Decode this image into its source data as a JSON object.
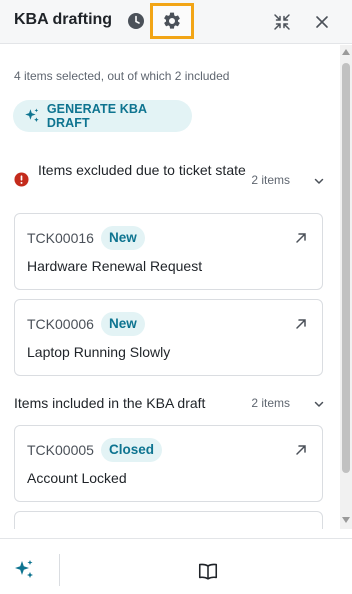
{
  "header": {
    "title": "KBA drafting",
    "icons": {
      "history": "clock-history-icon",
      "settings": "gear-icon",
      "collapse": "collapse-arrows-icon",
      "close": "close-icon"
    },
    "highlight_color": "#f2a516"
  },
  "summary": "4 items selected, out of which 2 included",
  "generate_button": {
    "label": "GENERATE KBA DRAFT",
    "icon": "sparkles-icon"
  },
  "excluded_section": {
    "title": "Items excluded due to ticket state",
    "count": "2 items",
    "icon": "error-circle-icon",
    "status_color": "#c42b1c",
    "items": [
      {
        "id": "TCK00016",
        "status": "New",
        "title": "Hardware Renewal Request"
      },
      {
        "id": "TCK00006",
        "status": "New",
        "title": "Laptop Running Slowly"
      }
    ]
  },
  "included_section": {
    "title": "Items included in the KBA draft",
    "count": "2 items",
    "items": [
      {
        "id": "TCK00005",
        "status": "Closed",
        "title": "Account Locked"
      }
    ]
  },
  "footer": {
    "icons": [
      "sparkles-icon",
      "book-icon"
    ]
  },
  "colors": {
    "accent": "#0e7490",
    "accent_bg": "#e3f3f5"
  }
}
